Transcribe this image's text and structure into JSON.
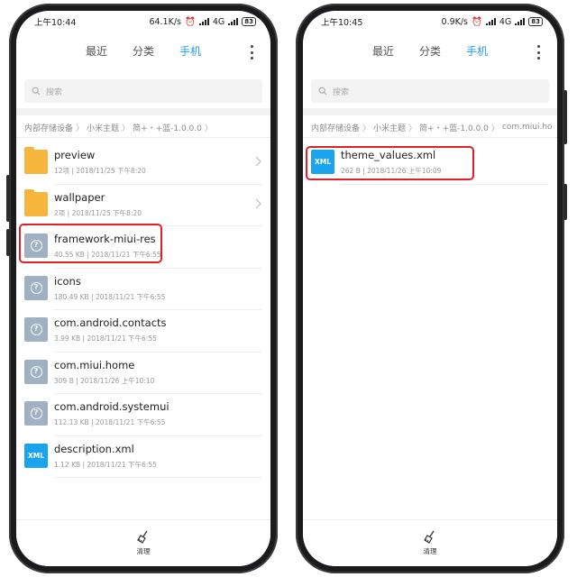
{
  "screens": [
    {
      "status": {
        "time": "上午10:44",
        "net_speed": "64.1K/s",
        "network": "4G",
        "battery": "83"
      },
      "tabs": [
        "最近",
        "分类",
        "手机"
      ],
      "active_tab": 2,
      "search": {
        "placeholder": "搜索"
      },
      "breadcrumb": [
        "内部存储设备",
        "小米主题",
        "简+・+蓝-1.0.0.0"
      ],
      "files": [
        {
          "name": "preview",
          "meta": "12项 | 2018/11/25 下午8:20",
          "icon": "folder-icon"
        },
        {
          "name": "wallpaper",
          "meta": "2项 | 2018/11/25 下午8:20",
          "icon": "folder-icon"
        },
        {
          "name": "framework-miui-res",
          "meta": "40.55 KB | 2018/11/21 下午6:55",
          "icon": "unknown-file-icon"
        },
        {
          "name": "icons",
          "meta": "180.49 KB | 2018/11/21 下午6:55",
          "icon": "unknown-file-icon"
        },
        {
          "name": "com.android.contacts",
          "meta": "3.99 KB | 2018/11/21 下午6:55",
          "icon": "unknown-file-icon"
        },
        {
          "name": "com.miui.home",
          "meta": "309 B | 2018/11/26 上午10:10",
          "icon": "unknown-file-icon"
        },
        {
          "name": "com.android.systemui",
          "meta": "112.13 KB | 2018/11/21 下午6:55",
          "icon": "unknown-file-icon"
        },
        {
          "name": "description.xml",
          "meta": "1.12 KB | 2018/11/21 下午6:55",
          "icon": "xml-file-icon"
        }
      ],
      "highlighted_file": "com.miui.home",
      "bottom": {
        "clean_label": "清理"
      }
    },
    {
      "status": {
        "time": "上午10:45",
        "net_speed": "0.9K/s",
        "network": "4G",
        "battery": "83"
      },
      "tabs": [
        "最近",
        "分类",
        "手机"
      ],
      "active_tab": 2,
      "search": {
        "placeholder": "搜索"
      },
      "breadcrumb": [
        "内部存储设备",
        "小米主题",
        "简+・+蓝-1.0.0.0",
        "com.miui.home"
      ],
      "files": [
        {
          "name": "theme_values.xml",
          "meta": "262 B | 2018/11/26 上午10:09",
          "icon": "xml-file-icon"
        }
      ],
      "highlighted_file": "theme_values.xml",
      "bottom": {
        "clean_label": "清理"
      }
    }
  ],
  "xml_icon_label": "XML",
  "highlight_color": "#e0202a",
  "accent_color": "#1f9cf0"
}
